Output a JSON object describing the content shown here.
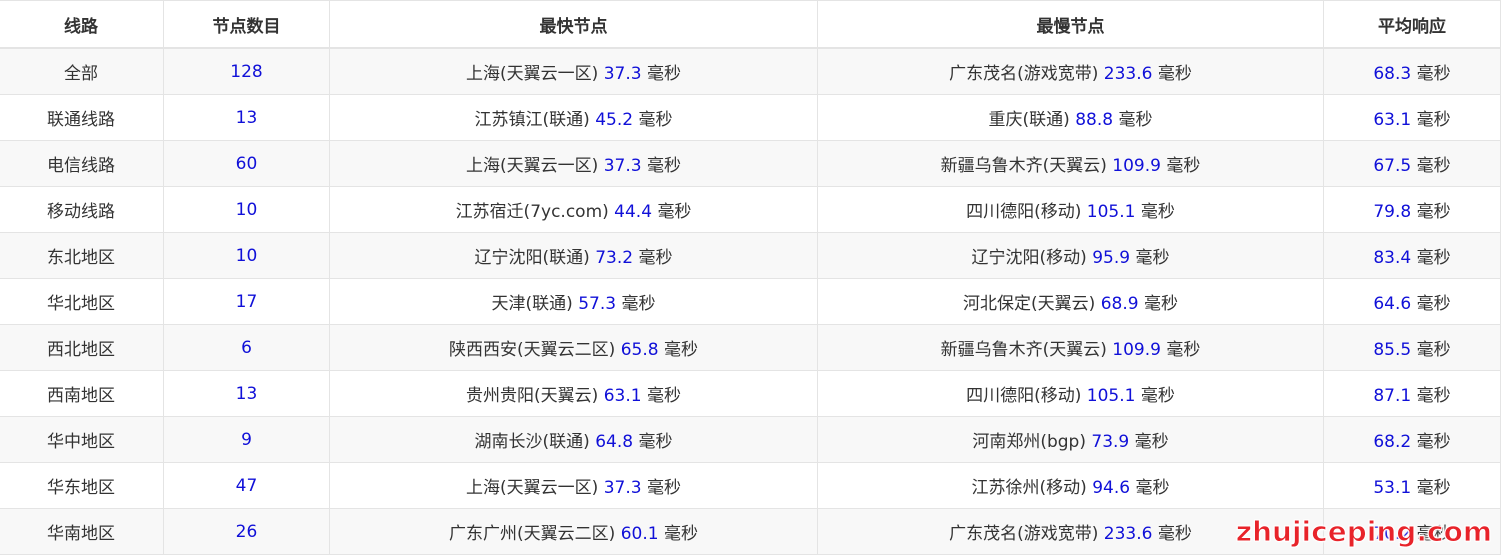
{
  "headers": [
    "线路",
    "节点数目",
    "最快节点",
    "最慢节点",
    "平均响应"
  ],
  "unit": "毫秒",
  "rows": [
    {
      "line": "全部",
      "count": "128",
      "fast_name": "上海(天翼云一区)",
      "fast_val": "37.3",
      "slow_name": "广东茂名(游戏宽带)",
      "slow_val": "233.6",
      "avg": "68.3"
    },
    {
      "line": "联通线路",
      "count": "13",
      "fast_name": "江苏镇江(联通)",
      "fast_val": "45.2",
      "slow_name": "重庆(联通)",
      "slow_val": "88.8",
      "avg": "63.1"
    },
    {
      "line": "电信线路",
      "count": "60",
      "fast_name": "上海(天翼云一区)",
      "fast_val": "37.3",
      "slow_name": "新疆乌鲁木齐(天翼云)",
      "slow_val": "109.9",
      "avg": "67.5"
    },
    {
      "line": "移动线路",
      "count": "10",
      "fast_name": "江苏宿迁(7yc.com)",
      "fast_val": "44.4",
      "slow_name": "四川德阳(移动)",
      "slow_val": "105.1",
      "avg": "79.8"
    },
    {
      "line": "东北地区",
      "count": "10",
      "fast_name": "辽宁沈阳(联通)",
      "fast_val": "73.2",
      "slow_name": "辽宁沈阳(移动)",
      "slow_val": "95.9",
      "avg": "83.4"
    },
    {
      "line": "华北地区",
      "count": "17",
      "fast_name": "天津(联通)",
      "fast_val": "57.3",
      "slow_name": "河北保定(天翼云)",
      "slow_val": "68.9",
      "avg": "64.6"
    },
    {
      "line": "西北地区",
      "count": "6",
      "fast_name": "陕西西安(天翼云二区)",
      "fast_val": "65.8",
      "slow_name": "新疆乌鲁木齐(天翼云)",
      "slow_val": "109.9",
      "avg": "85.5"
    },
    {
      "line": "西南地区",
      "count": "13",
      "fast_name": "贵州贵阳(天翼云)",
      "fast_val": "63.1",
      "slow_name": "四川德阳(移动)",
      "slow_val": "105.1",
      "avg": "87.1"
    },
    {
      "line": "华中地区",
      "count": "9",
      "fast_name": "湖南长沙(联通)",
      "fast_val": "64.8",
      "slow_name": "河南郑州(bgp)",
      "slow_val": "73.9",
      "avg": "68.2"
    },
    {
      "line": "华东地区",
      "count": "47",
      "fast_name": "上海(天翼云一区)",
      "fast_val": "37.3",
      "slow_name": "江苏徐州(移动)",
      "slow_val": "94.6",
      "avg": "53.1"
    },
    {
      "line": "华南地区",
      "count": "26",
      "fast_name": "广东广州(天翼云二区)",
      "fast_val": "60.1",
      "slow_name": "广东茂名(游戏宽带)",
      "slow_val": "233.6",
      "avg": "70.2"
    }
  ],
  "watermark": "zhujiceping.com"
}
